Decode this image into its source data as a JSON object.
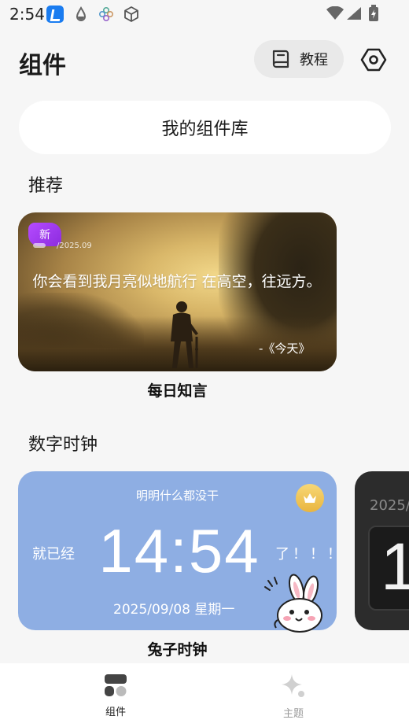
{
  "status_bar": {
    "time": "2:54"
  },
  "header": {
    "title": "组件",
    "tutorial_label": "教程"
  },
  "library": {
    "label": "我的组件库"
  },
  "sections": {
    "recommended": "推荐",
    "digital_clock": "数字时钟"
  },
  "recommended_card": {
    "badge": "新",
    "date": "/2025.09",
    "quote": "你会看到我月亮似地航行 在高空，往远方。",
    "source": "-《今天》",
    "caption": "每日知言"
  },
  "clock_card": {
    "top_text": "明明什么都没干",
    "prefix": "就已经",
    "time": "14:54",
    "suffix": "了！！！",
    "date": "2025/09/08 星期一",
    "caption": "兔子时钟",
    "background": "#8eaee3"
  },
  "peek_card": {
    "year": "2025/",
    "digit": "1"
  },
  "bottom_nav": {
    "items": [
      {
        "label": "组件",
        "icon": "widgets-icon",
        "active": true
      },
      {
        "label": "主题",
        "icon": "sparkle-icon",
        "active": false
      }
    ]
  },
  "colors": {
    "accent_purple": "#a23ef0",
    "clock_blue": "#8eaee3",
    "crown_gold": "#f0c354"
  }
}
